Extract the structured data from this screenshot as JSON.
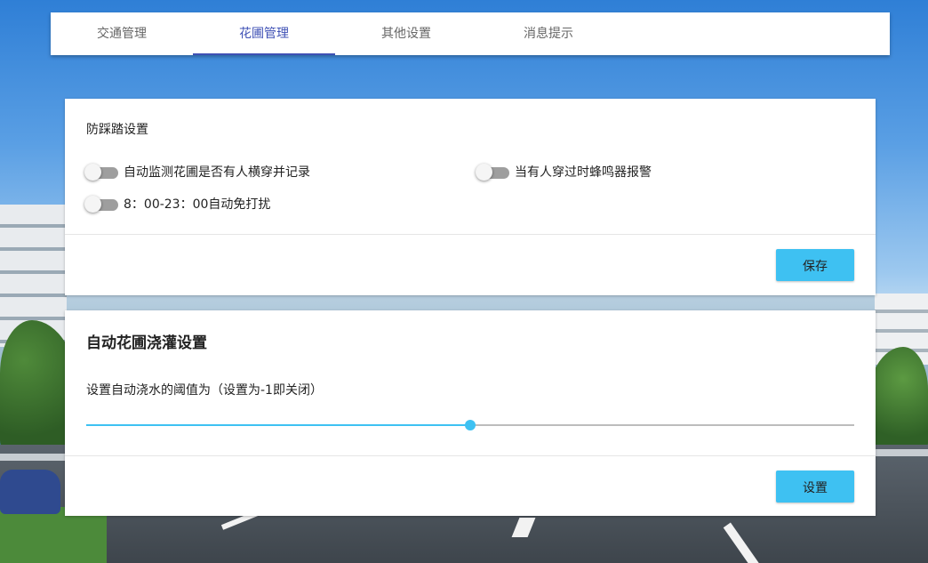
{
  "tabs": [
    {
      "label": "交通管理",
      "active": false
    },
    {
      "label": "花圃管理",
      "active": true
    },
    {
      "label": "其他设置",
      "active": false
    },
    {
      "label": "消息提示",
      "active": false
    }
  ],
  "anti_trample": {
    "title": "防踩踏设置",
    "switches": [
      {
        "label": "自动监测花圃是否有人横穿并记录",
        "on": false
      },
      {
        "label": "当有人穿过时蜂鸣器报警",
        "on": false
      },
      {
        "label": "8：00-23：00自动免打扰",
        "on": false
      }
    ],
    "save_label": "保存"
  },
  "irrigation": {
    "title": "自动花圃浇灌设置",
    "slider_label": "设置自动浇水的阈值为（设置为-1即关闭）",
    "slider_fraction": 0.5,
    "set_label": "设置"
  },
  "colors": {
    "accent": "#3f51b5",
    "button": "#3ec1f2",
    "slider": "#3ec1f2"
  }
}
